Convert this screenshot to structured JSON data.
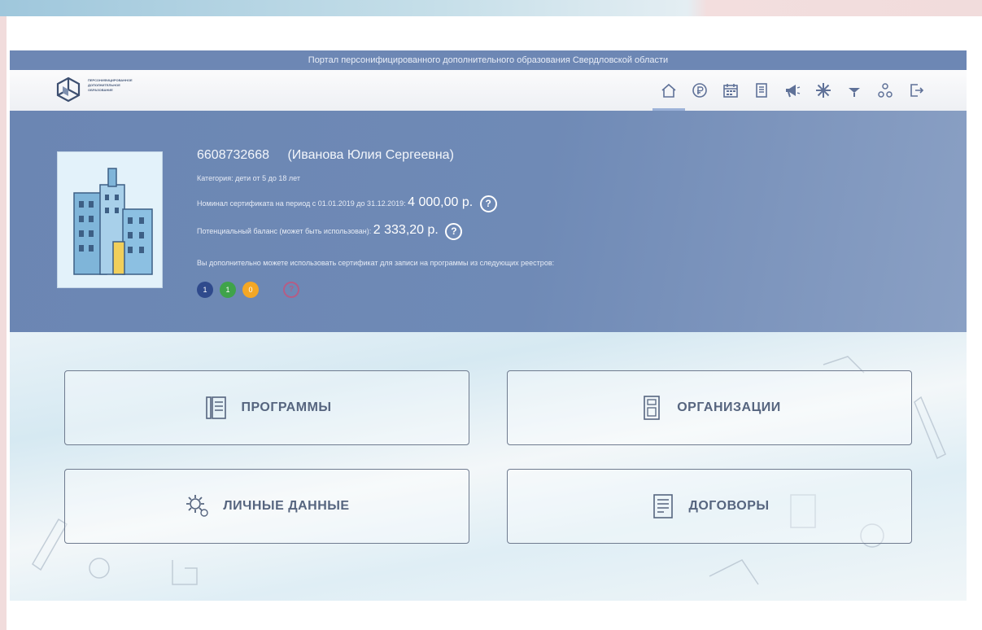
{
  "portal_title": "Портал персонифицированного дополнительного образования Свердловской области",
  "logo": {
    "text_line1": "персонифицированное",
    "text_line2": "дополнительное",
    "text_line3": "образование"
  },
  "nav_icons": [
    "home-icon",
    "rouble-icon",
    "calendar-icon",
    "document-icon",
    "megaphone-icon",
    "star-icon",
    "tree-icon",
    "people-icon",
    "logout-icon"
  ],
  "profile": {
    "certificate_number": "6608732668",
    "holder_name": "(Иванова Юлия Сергеевна)",
    "category": "Категория: дети от 5 до 18 лет",
    "nominal_label": "Номинал сертификата на период с 01.01.2019 до 31.12.2019:",
    "nominal_value": "4 000,00 р.",
    "balance_label": "Потенциальный баланс (может быть использован):",
    "balance_value": "2 333,20 р.",
    "registries_text": "Вы дополнительно можете использовать сертификат для записи на программы из следующих реестров:",
    "help_symbol": "?",
    "registries": [
      {
        "label": "1",
        "color": "#2f4a8c"
      },
      {
        "label": "1",
        "color": "#3fa34a"
      },
      {
        "label": "0",
        "color": "#f4a724"
      }
    ]
  },
  "tiles": {
    "programs": "ПРОГРАММЫ",
    "organizations": "ОРГАНИЗАЦИИ",
    "personal_data": "ЛИЧНЫЕ ДАННЫЕ",
    "contracts": "ДОГОВОРЫ"
  },
  "colors": {
    "portal_bar": "#6d87b4",
    "profile_bg": "#6f8ab6",
    "tile_border": "#6f7b8f",
    "tile_text": "#56657f"
  }
}
